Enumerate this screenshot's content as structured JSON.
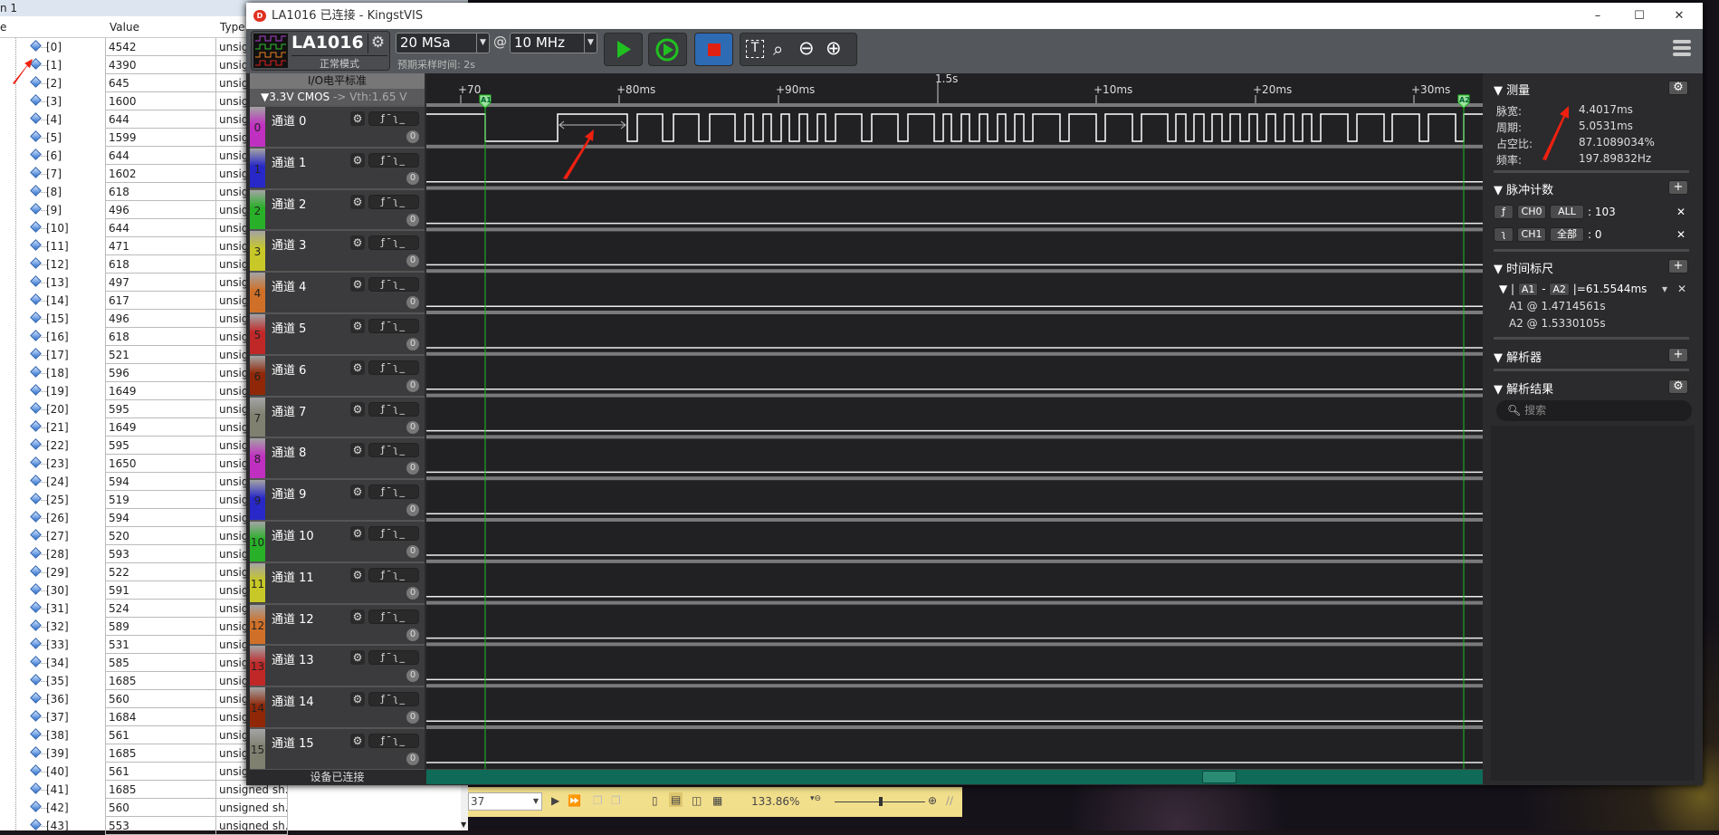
{
  "left_panel": {
    "title_fragment": "n 1",
    "headers": {
      "name": "e",
      "value": "Value",
      "type": "Type"
    },
    "rows": [
      {
        "index": "[0]",
        "value": "4542",
        "type": "unsig"
      },
      {
        "index": "[1]",
        "value": "4390",
        "type": "unsig"
      },
      {
        "index": "[2]",
        "value": "645",
        "type": "unsig"
      },
      {
        "index": "[3]",
        "value": "1600",
        "type": "unsig"
      },
      {
        "index": "[4]",
        "value": "644",
        "type": "unsig"
      },
      {
        "index": "[5]",
        "value": "1599",
        "type": "unsig"
      },
      {
        "index": "[6]",
        "value": "644",
        "type": "unsig"
      },
      {
        "index": "[7]",
        "value": "1602",
        "type": "unsig"
      },
      {
        "index": "[8]",
        "value": "618",
        "type": "unsig"
      },
      {
        "index": "[9]",
        "value": "496",
        "type": "unsig"
      },
      {
        "index": "[10]",
        "value": "644",
        "type": "unsig"
      },
      {
        "index": "[11]",
        "value": "471",
        "type": "unsig"
      },
      {
        "index": "[12]",
        "value": "618",
        "type": "unsig"
      },
      {
        "index": "[13]",
        "value": "497",
        "type": "unsig"
      },
      {
        "index": "[14]",
        "value": "617",
        "type": "unsig"
      },
      {
        "index": "[15]",
        "value": "496",
        "type": "unsig"
      },
      {
        "index": "[16]",
        "value": "618",
        "type": "unsig"
      },
      {
        "index": "[17]",
        "value": "521",
        "type": "unsig"
      },
      {
        "index": "[18]",
        "value": "596",
        "type": "unsig"
      },
      {
        "index": "[19]",
        "value": "1649",
        "type": "unsig"
      },
      {
        "index": "[20]",
        "value": "595",
        "type": "unsig"
      },
      {
        "index": "[21]",
        "value": "1649",
        "type": "unsig"
      },
      {
        "index": "[22]",
        "value": "595",
        "type": "unsig"
      },
      {
        "index": "[23]",
        "value": "1650",
        "type": "unsig"
      },
      {
        "index": "[24]",
        "value": "594",
        "type": "unsig"
      },
      {
        "index": "[25]",
        "value": "519",
        "type": "unsig"
      },
      {
        "index": "[26]",
        "value": "594",
        "type": "unsig"
      },
      {
        "index": "[27]",
        "value": "520",
        "type": "unsig"
      },
      {
        "index": "[28]",
        "value": "593",
        "type": "unsig"
      },
      {
        "index": "[29]",
        "value": "522",
        "type": "unsig"
      },
      {
        "index": "[30]",
        "value": "591",
        "type": "unsig"
      },
      {
        "index": "[31]",
        "value": "524",
        "type": "unsig"
      },
      {
        "index": "[32]",
        "value": "589",
        "type": "unsig"
      },
      {
        "index": "[33]",
        "value": "531",
        "type": "unsig"
      },
      {
        "index": "[34]",
        "value": "585",
        "type": "unsig"
      },
      {
        "index": "[35]",
        "value": "1685",
        "type": "unsig"
      },
      {
        "index": "[36]",
        "value": "560",
        "type": "unsig"
      },
      {
        "index": "[37]",
        "value": "1684",
        "type": "unsig"
      },
      {
        "index": "[38]",
        "value": "561",
        "type": "unsig"
      },
      {
        "index": "[39]",
        "value": "1685",
        "type": "unsig"
      },
      {
        "index": "[40]",
        "value": "561",
        "type": "unsig"
      },
      {
        "index": "[41]",
        "value": "1685",
        "type": "unsigned sh..."
      },
      {
        "index": "[42]",
        "value": "560",
        "type": "unsigned sh..."
      },
      {
        "index": "[43]",
        "value": "553",
        "type": "unsigned sh..."
      }
    ]
  },
  "window": {
    "title": "LA1016 已连接 - KingstVIS",
    "minimize": "–",
    "maximize": "☐",
    "close": "✕"
  },
  "toolbar": {
    "device": "LA1016",
    "mode": "正常模式",
    "sample_depth": "20 MSa",
    "at": "@",
    "sample_rate": "10 MHz",
    "expected_time": "预期采样时间: 2s",
    "start_icon": "play-icon",
    "loop_icon": "loop-icon",
    "stop_icon": "stop-icon",
    "stop_color": "#e02010",
    "tools": [
      "T",
      "⌕",
      "⊖",
      "⊕"
    ],
    "menu_icon": "hamburger-icon"
  },
  "io_standard": {
    "title": "I/O电平标准",
    "value": "▼3.3V CMOS",
    "vth": "-> Vth:1.65 V"
  },
  "channels": [
    {
      "num": "0",
      "name": "通道 0",
      "count": "0",
      "color": "#c030c0"
    },
    {
      "num": "1",
      "name": "通道 1",
      "count": "0",
      "color": "#2828c8"
    },
    {
      "num": "2",
      "name": "通道 2",
      "count": "0",
      "color": "#28b028"
    },
    {
      "num": "3",
      "name": "通道 3",
      "count": "0",
      "color": "#c8c828"
    },
    {
      "num": "4",
      "name": "通道 4",
      "count": "0",
      "color": "#d07028"
    },
    {
      "num": "5",
      "name": "通道 5",
      "count": "0",
      "color": "#c02828"
    },
    {
      "num": "6",
      "name": "通道 6",
      "count": "0",
      "color": "#902808"
    },
    {
      "num": "7",
      "name": "通道 7",
      "count": "0",
      "color": "#808070"
    },
    {
      "num": "8",
      "name": "通道 8",
      "count": "0",
      "color": "#c030c0"
    },
    {
      "num": "9",
      "name": "通道 9",
      "count": "0",
      "color": "#2828c8"
    },
    {
      "num": "10",
      "name": "通道 10",
      "count": "0",
      "color": "#28b028"
    },
    {
      "num": "11",
      "name": "通道 11",
      "count": "0",
      "color": "#c8c828"
    },
    {
      "num": "12",
      "name": "通道 12",
      "count": "0",
      "color": "#d07028"
    },
    {
      "num": "13",
      "name": "通道 13",
      "count": "0",
      "color": "#c02828"
    },
    {
      "num": "14",
      "name": "通道 14",
      "count": "0",
      "color": "#902808"
    },
    {
      "num": "15",
      "name": "通道 15",
      "count": "0",
      "color": "#808070"
    }
  ],
  "trigger_glyphs": "ƒ¯ʅ_",
  "status": "设备已连接",
  "ruler": {
    "labels": [
      "+70",
      "+80ms",
      "+90ms",
      "1.5s",
      "+10ms",
      "+20ms",
      "+30ms"
    ],
    "cursor_a1": "A1",
    "cursor_a2": "A2",
    "cursor_color": "#20c020"
  },
  "measure": {
    "title": "测量",
    "rows": [
      {
        "label": "脉宽:",
        "value": "4.4017ms"
      },
      {
        "label": "周期:",
        "value": "5.0531ms"
      },
      {
        "label": "占空比:",
        "value": "87.1089034%"
      },
      {
        "label": "频率:",
        "value": "197.89832Hz"
      }
    ]
  },
  "pulse_count": {
    "title": "脉冲计数",
    "rows": [
      {
        "edge": "rising-edge-icon",
        "channel": "CH0",
        "scope": "ALL",
        "value": ": 103"
      },
      {
        "edge": "falling-edge-icon",
        "channel": "CH1",
        "scope": "全部",
        "value": ": 0"
      }
    ]
  },
  "timeruler": {
    "title": "时间标尺",
    "a1": "A1",
    "a2": "A2",
    "diff": "=61.5544ms",
    "a1_pos": "A1 @ 1.4714561s",
    "a2_pos": "A2 @ 1.5330105s"
  },
  "decoder": {
    "title": "解析器"
  },
  "decode_results": {
    "title": "解析结果",
    "search_placeholder": "搜索"
  },
  "viewer_toolbar": {
    "page": "37",
    "zoom": "133.86%"
  }
}
